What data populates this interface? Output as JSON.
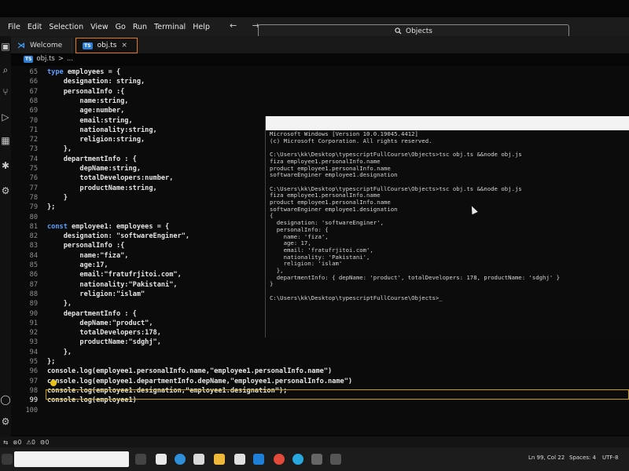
{
  "menu": [
    "File",
    "Edit",
    "Selection",
    "View",
    "Go",
    "Run",
    "Terminal",
    "Help"
  ],
  "nav_arrows": "← →",
  "search": {
    "icon": "search-icon",
    "label": "Objects"
  },
  "tabs": [
    {
      "label": "Welcome",
      "icon": "vscode-icon"
    },
    {
      "label": "obj.ts",
      "icon": "ts-icon",
      "close": "×"
    }
  ],
  "breadcrumb": {
    "file": "obj.ts",
    "sep": ">",
    "rest": "..."
  },
  "activity_icons": [
    "explorer-icon",
    "search-icon",
    "source-control-icon",
    "run-debug-icon",
    "extensions-icon",
    "debug-icon",
    "remote-icon",
    "account-icon",
    "settings-icon"
  ],
  "editor": {
    "lines": [
      {
        "n": "65",
        "code": "type employees = {"
      },
      {
        "n": "66",
        "code": "    designation: string,"
      },
      {
        "n": "67",
        "code": "    personalInfo :{"
      },
      {
        "n": "68",
        "code": "        name:string,"
      },
      {
        "n": "69",
        "code": "        age:number,"
      },
      {
        "n": "70",
        "code": "        email:string,"
      },
      {
        "n": "71",
        "code": "        nationality:string,"
      },
      {
        "n": "72",
        "code": "        religion:string,"
      },
      {
        "n": "73",
        "code": "    },"
      },
      {
        "n": "74",
        "code": "    departmentInfo : {"
      },
      {
        "n": "75",
        "code": "        depName:string,"
      },
      {
        "n": "76",
        "code": "        totalDevelopers:number,"
      },
      {
        "n": "77",
        "code": "        productName:string,"
      },
      {
        "n": "78",
        "code": "    }"
      },
      {
        "n": "79",
        "code": "};"
      },
      {
        "n": "80",
        "code": ""
      },
      {
        "n": "81",
        "code": "const employee1: employees = {"
      },
      {
        "n": "82",
        "code": "    designation: \"softwareEnginer\","
      },
      {
        "n": "83",
        "code": "    personalInfo :{"
      },
      {
        "n": "84",
        "code": "        name:\"fiza\","
      },
      {
        "n": "85",
        "code": "        age:17,"
      },
      {
        "n": "86",
        "code": "        email:\"fratufrjitoi.com\","
      },
      {
        "n": "87",
        "code": "        nationality:\"Pakistani\","
      },
      {
        "n": "88",
        "code": "        religion:\"islam\""
      },
      {
        "n": "89",
        "code": "    },"
      },
      {
        "n": "90",
        "code": "    departmentInfo : {"
      },
      {
        "n": "91",
        "code": "        depName:\"product\","
      },
      {
        "n": "92",
        "code": "        totalDevelopers:178,"
      },
      {
        "n": "93",
        "code": "        productName:\"sdghj\","
      },
      {
        "n": "94",
        "code": "    },"
      },
      {
        "n": "95",
        "code": "};"
      },
      {
        "n": "96",
        "code": "console.log(employee1.personalInfo.name,\"employee1.personalInfo.name\")"
      },
      {
        "n": "97",
        "code": "console.log(employee1.departmentInfo.depName,\"employee1.personalInfo.name\")"
      },
      {
        "n": "98",
        "code": "console.log(employee1.designation,\"employee1.designation\");"
      },
      {
        "n": "99",
        "code": "console.log(employee1)"
      },
      {
        "n": "100",
        "code": ""
      }
    ]
  },
  "terminal": {
    "lines": [
      "Microsoft Windows [Version 10.0.19045.4412]",
      "(c) Microsoft Corporation. All rights reserved.",
      "",
      "C:\\Users\\kk\\Desktop\\typescriptFullCourse\\Objects>tsc obj.ts &&node obj.js",
      "fiza employee1.personalInfo.name",
      "product employee1.personalInfo.name",
      "softwareEnginer employee1.designation",
      "",
      "C:\\Users\\kk\\Desktop\\typescriptFullCourse\\Objects>tsc obj.ts &&node obj.js",
      "fiza employee1.personalInfo.name",
      "product employee1.personalInfo.name",
      "softwareEnginer employee1.designation",
      "{",
      "  designation: 'softwareEnginer',",
      "  personalInfo: {",
      "    name: 'fiza',",
      "    age: 17,",
      "    email: 'fratufrjitoi.com',",
      "    nationality: 'Pakistani',",
      "    religion: 'islam'",
      "  },",
      "  departmentInfo: { depName: 'product', totalDevelopers: 178, productName: 'sdghj' }",
      "}",
      "",
      "C:\\Users\\kk\\Desktop\\typescriptFullCourse\\Objects>_"
    ]
  },
  "status": {
    "errors": "⊗0",
    "warnings": "⚠0",
    "ports": "⚙0",
    "position": "Ln 99, Col 22",
    "spaces": "Spaces: 4",
    "encoding": "UTF-8"
  },
  "colors": {
    "keyword": "#5aa0ff",
    "accent": "#e07a1a",
    "current_line": "#caa100",
    "terminal_title": "#f3f3f3"
  }
}
